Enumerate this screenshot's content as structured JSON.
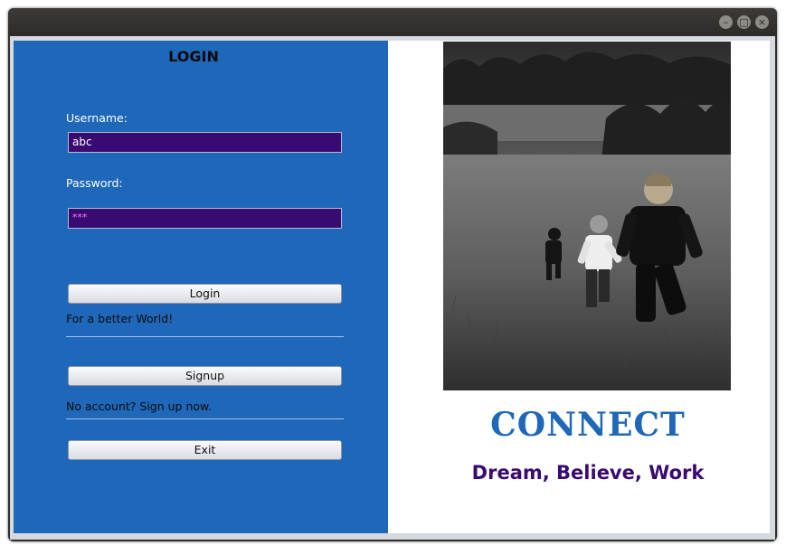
{
  "window": {
    "minimize_icon": "minimize-icon",
    "maximize_icon": "maximize-icon",
    "close_icon": "close-icon"
  },
  "login": {
    "title": "LOGIN",
    "username_label": "Username:",
    "username_value": "abc",
    "password_label": "Password:",
    "password_value": "***",
    "login_button": "Login",
    "login_note": "For a better World!",
    "signup_button": "Signup",
    "signup_note": "No account? Sign up now.",
    "exit_button": "Exit"
  },
  "brand": {
    "name": "CONNECT",
    "tagline": "Dream, Believe, Work",
    "image": "children-running-in-field-photo"
  },
  "colors": {
    "panel_blue": "#1f67b9",
    "field_purple": "#390a72",
    "tagline_purple": "#3a0a6f",
    "brand_blue": "#1f67b9"
  }
}
